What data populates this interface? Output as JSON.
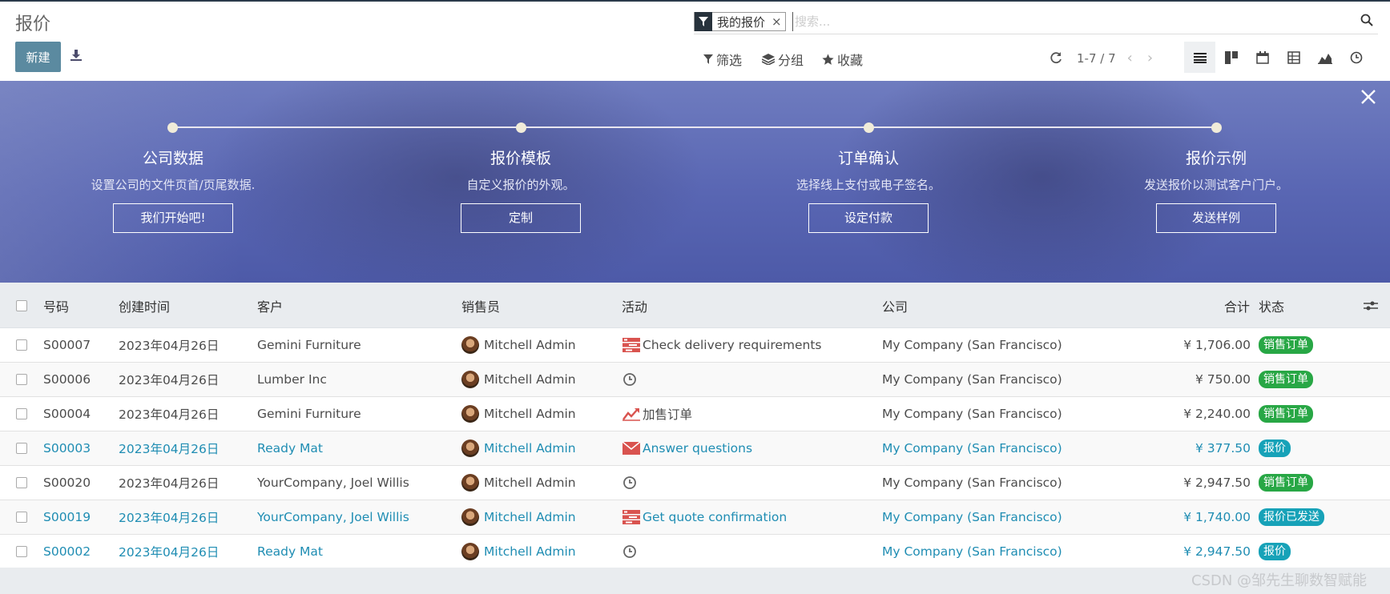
{
  "title": "报价",
  "toolbar": {
    "new_label": "新建"
  },
  "search": {
    "facet_value": "我的报价",
    "facet_remove": "×",
    "placeholder": "搜索..."
  },
  "filters": {
    "filter_label": "筛选",
    "group_label": "分组",
    "favorite_label": "收藏"
  },
  "pager": {
    "range": "1-7 / 7"
  },
  "banner": {
    "steps": [
      {
        "title": "公司数据",
        "desc": "设置公司的文件页首/页尾数据.",
        "button": "我们开始吧!"
      },
      {
        "title": "报价模板",
        "desc": "自定义报价的外观。",
        "button": "定制"
      },
      {
        "title": "订单确认",
        "desc": "选择线上支付或电子签名。",
        "button": "设定付款"
      },
      {
        "title": "报价示例",
        "desc": "发送报价以测试客户门户。",
        "button": "发送样例"
      }
    ]
  },
  "table": {
    "headers": {
      "number": "号码",
      "created": "创建时间",
      "customer": "客户",
      "salesperson": "销售员",
      "activity": "活动",
      "company": "公司",
      "total": "合计",
      "status": "状态"
    },
    "rows": [
      {
        "number": "S00007",
        "created": "2023年04月26日",
        "customer": "Gemini Furniture",
        "salesperson": "Mitchell Admin",
        "activity_icon": "task-list-icon",
        "activity": "Check delivery requirements",
        "company": "My Company (San Francisco)",
        "total": "¥ 1,706.00",
        "status": "销售订单"
      },
      {
        "number": "S00006",
        "created": "2023年04月26日",
        "customer": "Lumber Inc",
        "salesperson": "Mitchell Admin",
        "activity_icon": "clock-icon",
        "activity": "",
        "company": "My Company (San Francisco)",
        "total": "¥ 750.00",
        "status": "销售订单"
      },
      {
        "number": "S00004",
        "created": "2023年04月26日",
        "customer": "Gemini Furniture",
        "salesperson": "Mitchell Admin",
        "activity_icon": "upsell-chart-icon",
        "activity": "加售订单",
        "company": "My Company (San Francisco)",
        "total": "¥ 2,240.00",
        "status": "销售订单"
      },
      {
        "number": "S00003",
        "created": "2023年04月26日",
        "customer": "Ready Mat",
        "salesperson": "Mitchell Admin",
        "activity_icon": "envelope-icon",
        "activity": "Answer questions",
        "company": "My Company (San Francisco)",
        "total": "¥ 377.50",
        "status": "报价"
      },
      {
        "number": "S00020",
        "created": "2023年04月26日",
        "customer": "YourCompany, Joel Willis",
        "salesperson": "Mitchell Admin",
        "activity_icon": "clock-icon",
        "activity": "",
        "company": "My Company (San Francisco)",
        "total": "¥ 2,947.50",
        "status": "销售订单"
      },
      {
        "number": "S00019",
        "created": "2023年04月26日",
        "customer": "YourCompany, Joel Willis",
        "salesperson": "Mitchell Admin",
        "activity_icon": "task-list-icon",
        "activity": "Get quote confirmation",
        "company": "My Company (San Francisco)",
        "total": "¥ 1,740.00",
        "status": "报价已发送"
      },
      {
        "number": "S00002",
        "created": "2023年04月26日",
        "customer": "Ready Mat",
        "salesperson": "Mitchell Admin",
        "activity_icon": "clock-icon",
        "activity": "",
        "company": "My Company (San Francisco)",
        "total": "¥ 2,947.50",
        "status": "报价"
      }
    ]
  },
  "watermark": "CSDN @邹先生聊数智赋能",
  "colors": {
    "accent": "#5b8aa0",
    "status_sale": "#28a745",
    "status_quote": "#17a2b8",
    "link": "#1f8db3",
    "activity_red": "#d9534f"
  }
}
